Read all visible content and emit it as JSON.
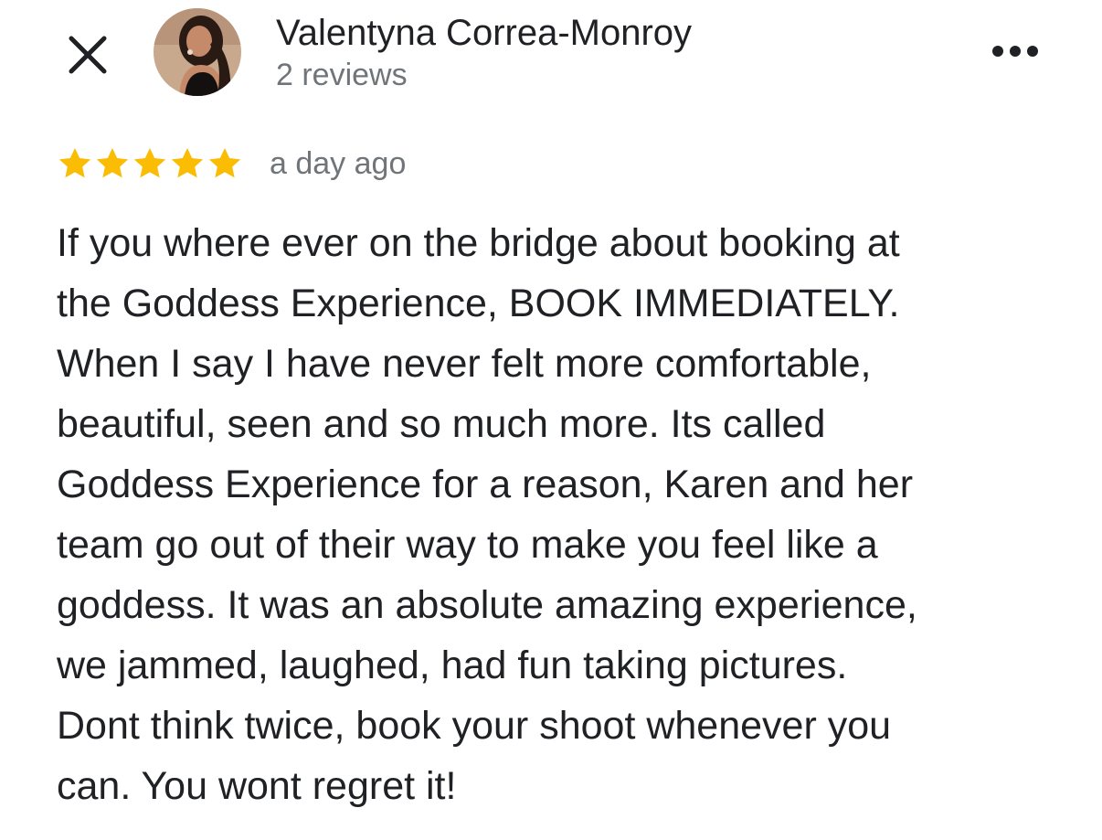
{
  "header": {
    "close_icon": "close-icon",
    "more_icon": "more-horizontal-icon",
    "avatar": "avatar"
  },
  "reviewer": {
    "name": "Valentyna Correa-Monroy",
    "review_count": "2 reviews"
  },
  "review": {
    "rating": 5,
    "max_rating": 5,
    "star_color": "#fbbc04",
    "date": "a day ago",
    "text_lines": [
      "If you where ever on the bridge about booking at",
      "the Goddess Experience, BOOK IMMEDIATELY.",
      "When I say I have never felt more comfortable,",
      "beautiful, seen and so much more. Its called",
      "Goddess Experience for a reason, Karen and her",
      "team go out of their way to make you feel like a",
      "goddess. It was an absolute amazing experience,",
      "we jammed, laughed, had fun taking pictures.",
      "Dont think twice, book your shoot whenever you",
      "can. You wont regret it!"
    ]
  },
  "colors": {
    "primary_text": "#202124",
    "secondary_text": "#70757a"
  }
}
